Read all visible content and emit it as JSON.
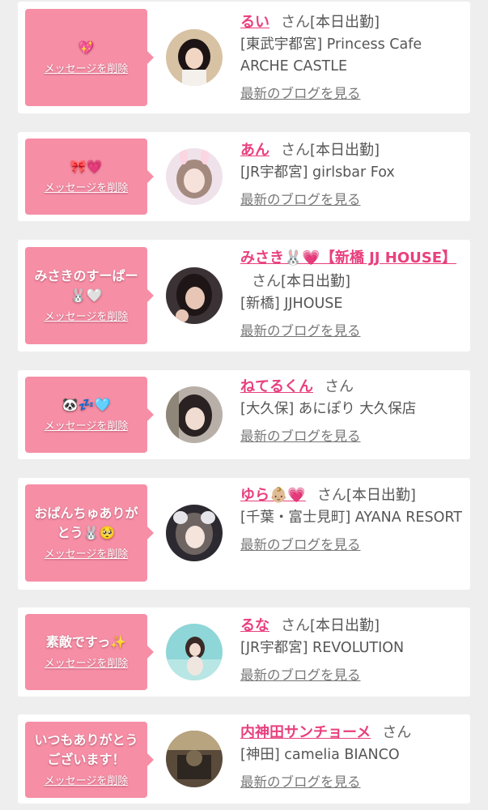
{
  "delete_label": "メッセージを削除",
  "honorific": "さん",
  "blog_link_label": "最新のブログを見る",
  "colors": {
    "message_box": "#f68ea6",
    "name_link": "#e8407e",
    "background": "#eeeeee"
  },
  "items": [
    {
      "message": "💖",
      "name": "るい",
      "status": "[本日出勤]",
      "shop": "[東武宇都宮] Princess Cafe ARCHE CASTLE",
      "avatar": "avatar-photo"
    },
    {
      "message": "🎀💗",
      "name": "あん",
      "status": "[本日出勤]",
      "shop": "[JR宇都宮] girlsbar Fox",
      "avatar": "avatar-photo"
    },
    {
      "message": "みさきのすーぱー🐰🤍",
      "name": "みさき🐰💗【新橋 JJ HOUSE】",
      "status": "[本日出勤]",
      "shop": "[新橋] JJHOUSE",
      "avatar": "avatar-photo"
    },
    {
      "message": "🐼💤🩵",
      "name": "ねてるくん",
      "status": "",
      "shop": "[大久保] あにぽり 大久保店",
      "avatar": "avatar-photo"
    },
    {
      "message": "おぱんちゅありがとう🐰🥺",
      "name": "ゆら👶🏼💗",
      "status": "[本日出勤]",
      "shop": "[千葉・富士見町] AYANA RESORT",
      "avatar": "avatar-photo"
    },
    {
      "message": "素敵ですっ✨",
      "name": "るな",
      "status": "[本日出勤]",
      "shop": "[JR宇都宮] REVOLUTION",
      "avatar": "avatar-photo"
    },
    {
      "message": "いつもありがとうございます！",
      "name": "内神田サンチョーメ",
      "status": "",
      "shop": "[神田] camelia BIANCO",
      "avatar": "avatar-photo"
    }
  ]
}
